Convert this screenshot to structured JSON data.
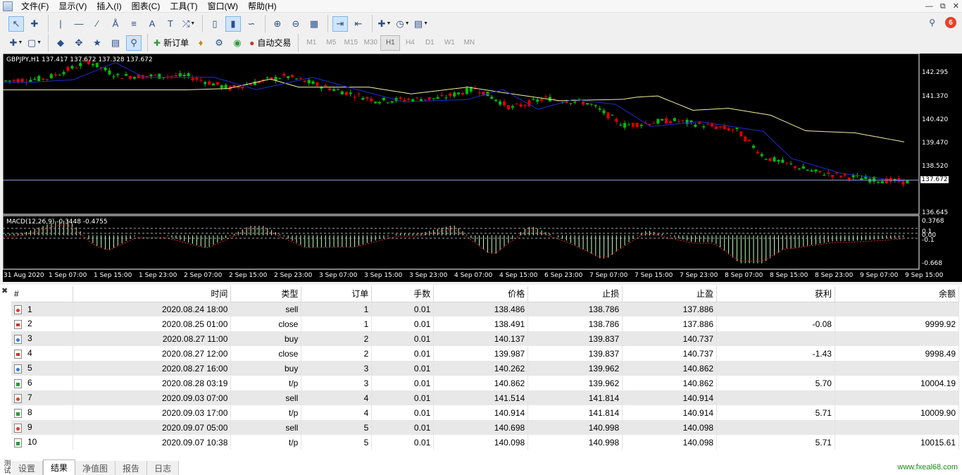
{
  "menubar": {
    "items": [
      "文件(F)",
      "显示(V)",
      "插入(I)",
      "图表(C)",
      "工具(T)",
      "窗口(W)",
      "帮助(H)"
    ]
  },
  "toolbar": {
    "new_order_label": "新订单",
    "auto_trade_label": "自动交易",
    "timeframes": [
      "M1",
      "M5",
      "M15",
      "M30",
      "H1",
      "H4",
      "D1",
      "W1",
      "MN"
    ],
    "active_timeframe": "H1",
    "notification_count": "6"
  },
  "chart": {
    "header": "GBPJPY,H1  137.417 137.672 137.328 137.672",
    "macd_header": "MACD(12,26,9) -0.3448 -0.4755",
    "current_price": "137.672",
    "price_ticks": [
      "142.295",
      "141.370",
      "140.420",
      "139.470",
      "138.520",
      "136.645"
    ],
    "macd_ticks": [
      "0.3768",
      "0.1",
      "0.00",
      "-0.1",
      "-0.668"
    ],
    "time_ticks": [
      "31 Aug 2020",
      "1 Sep 07:00",
      "1 Sep 15:00",
      "1 Sep 23:00",
      "2 Sep 07:00",
      "2 Sep 15:00",
      "2 Sep 23:00",
      "3 Sep 07:00",
      "3 Sep 15:00",
      "3 Sep 23:00",
      "4 Sep 07:00",
      "4 Sep 15:00",
      "6 Sep 23:00",
      "7 Sep 07:00",
      "7 Sep 15:00",
      "7 Sep 23:00",
      "8 Sep 07:00",
      "8 Sep 15:00",
      "8 Sep 23:00",
      "9 Sep 07:00",
      "9 Sep 15:00"
    ],
    "colors": {
      "background": "#000000",
      "bull": "#00c000",
      "bear": "#e00000",
      "ma_fast": "#1a2fd0",
      "ma_slow": "#f0f0a0",
      "macd_hist": "#c0ffc0",
      "macd_signal": "#e02020"
    }
  },
  "results": {
    "columns": [
      "#",
      "时间",
      "类型",
      "订单",
      "手数",
      "价格",
      "止损",
      "止盈",
      "获利",
      "余额"
    ],
    "rows": [
      {
        "num": "1",
        "icon": "sell",
        "time": "2020.08.24 18:00",
        "type": "sell",
        "order": "1",
        "lots": "0.01",
        "price": "138.486",
        "sl": "138.786",
        "tp": "137.886",
        "profit": "",
        "balance": ""
      },
      {
        "num": "2",
        "icon": "close",
        "time": "2020.08.25 01:00",
        "type": "close",
        "order": "1",
        "lots": "0.01",
        "price": "138.491",
        "sl": "138.786",
        "tp": "137.886",
        "profit": "-0.08",
        "balance": "9999.92"
      },
      {
        "num": "3",
        "icon": "buy",
        "time": "2020.08.27 11:00",
        "type": "buy",
        "order": "2",
        "lots": "0.01",
        "price": "140.137",
        "sl": "139.837",
        "tp": "140.737",
        "profit": "",
        "balance": ""
      },
      {
        "num": "4",
        "icon": "close",
        "time": "2020.08.27 12:00",
        "type": "close",
        "order": "2",
        "lots": "0.01",
        "price": "139.987",
        "sl": "139.837",
        "tp": "140.737",
        "profit": "-1.43",
        "balance": "9998.49"
      },
      {
        "num": "5",
        "icon": "buy",
        "time": "2020.08.27 16:00",
        "type": "buy",
        "order": "3",
        "lots": "0.01",
        "price": "140.262",
        "sl": "139.962",
        "tp": "140.862",
        "profit": "",
        "balance": ""
      },
      {
        "num": "6",
        "icon": "tp",
        "time": "2020.08.28 03:19",
        "type": "t/p",
        "order": "3",
        "lots": "0.01",
        "price": "140.862",
        "sl": "139.962",
        "tp": "140.862",
        "profit": "5.70",
        "balance": "10004.19"
      },
      {
        "num": "7",
        "icon": "sell",
        "time": "2020.09.03 07:00",
        "type": "sell",
        "order": "4",
        "lots": "0.01",
        "price": "141.514",
        "sl": "141.814",
        "tp": "140.914",
        "profit": "",
        "balance": ""
      },
      {
        "num": "8",
        "icon": "tp",
        "time": "2020.09.03 17:00",
        "type": "t/p",
        "order": "4",
        "lots": "0.01",
        "price": "140.914",
        "sl": "141.814",
        "tp": "140.914",
        "profit": "5.71",
        "balance": "10009.90"
      },
      {
        "num": "9",
        "icon": "sell",
        "time": "2020.09.07 05:00",
        "type": "sell",
        "order": "5",
        "lots": "0.01",
        "price": "140.698",
        "sl": "140.998",
        "tp": "140.098",
        "profit": "",
        "balance": ""
      },
      {
        "num": "10",
        "icon": "tp",
        "time": "2020.09.07 10:38",
        "type": "t/p",
        "order": "5",
        "lots": "0.01",
        "price": "140.098",
        "sl": "140.998",
        "tp": "140.098",
        "profit": "5.71",
        "balance": "10015.61"
      }
    ]
  },
  "tabs": [
    "设置",
    "结果",
    "净值图",
    "报告",
    "日志"
  ],
  "active_tab": "结果",
  "side_label": "测试",
  "watermark": "www.fxeal68.com"
}
